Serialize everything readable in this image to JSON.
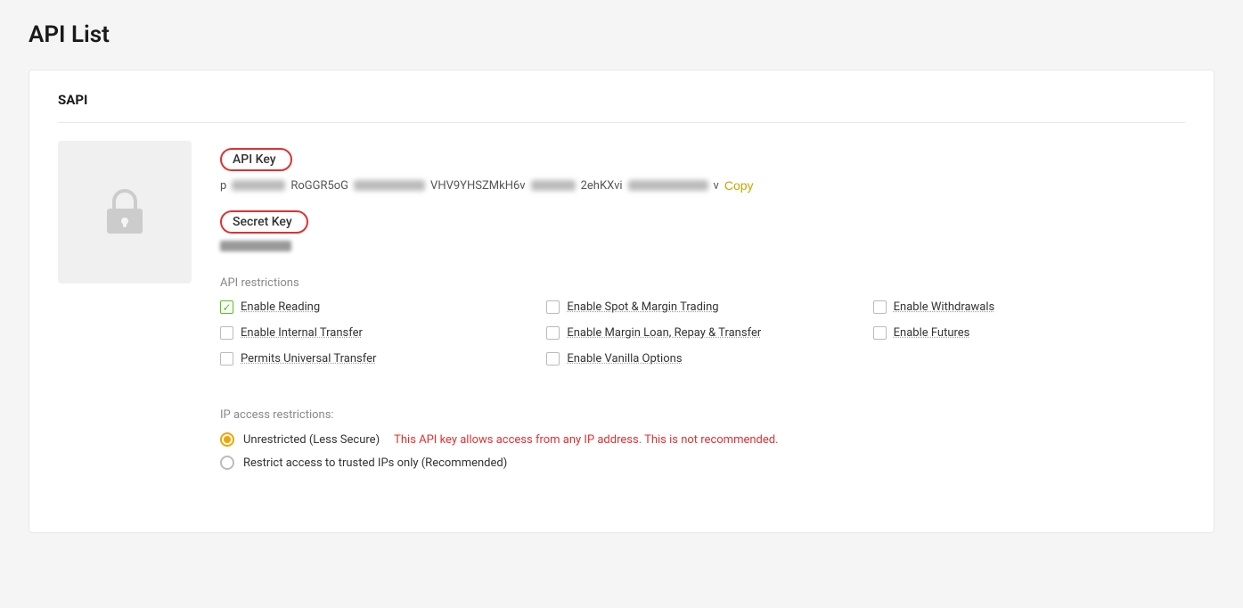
{
  "page": {
    "title": "API List"
  },
  "section": {
    "label": "SAPI"
  },
  "api_key": {
    "label": "API Key",
    "partial_start": "p••••X1•RoGGR5oG",
    "partial_middle": "•••VHV9YHSZMkH6v••",
    "partial_middle2": "•••2ehKXvi•",
    "partial_end": "•••••••••v",
    "copy_label": "Copy"
  },
  "secret_key": {
    "label": "Secret Key"
  },
  "restrictions": {
    "title": "API restrictions",
    "items": [
      {
        "id": "enable-reading",
        "label": "Enable Reading",
        "checked": true,
        "row": 0,
        "col": 0
      },
      {
        "id": "enable-spot-margin",
        "label": "Enable Spot & Margin Trading",
        "checked": false,
        "row": 0,
        "col": 1
      },
      {
        "id": "enable-withdrawals",
        "label": "Enable Withdrawals",
        "checked": false,
        "row": 0,
        "col": 2
      },
      {
        "id": "enable-internal-transfer",
        "label": "Enable Internal Transfer",
        "checked": false,
        "row": 1,
        "col": 0
      },
      {
        "id": "enable-margin-loan",
        "label": "Enable Margin Loan, Repay & Transfer",
        "checked": false,
        "row": 1,
        "col": 1
      },
      {
        "id": "enable-futures",
        "label": "Enable Futures",
        "checked": false,
        "row": 1,
        "col": 2
      },
      {
        "id": "permits-universal-transfer",
        "label": "Permits Universal Transfer",
        "checked": false,
        "row": 2,
        "col": 0
      },
      {
        "id": "enable-vanilla-options",
        "label": "Enable Vanilla Options",
        "checked": false,
        "row": 2,
        "col": 1
      }
    ]
  },
  "ip_access": {
    "title": "IP access restrictions:",
    "options": [
      {
        "id": "unrestricted",
        "label": "Unrestricted (Less Secure)",
        "warning": "This API key allows access from any IP address. This is not recommended.",
        "selected": true
      },
      {
        "id": "restrict",
        "label": "Restrict access to trusted IPs only (Recommended)",
        "warning": "",
        "selected": false
      }
    ]
  }
}
